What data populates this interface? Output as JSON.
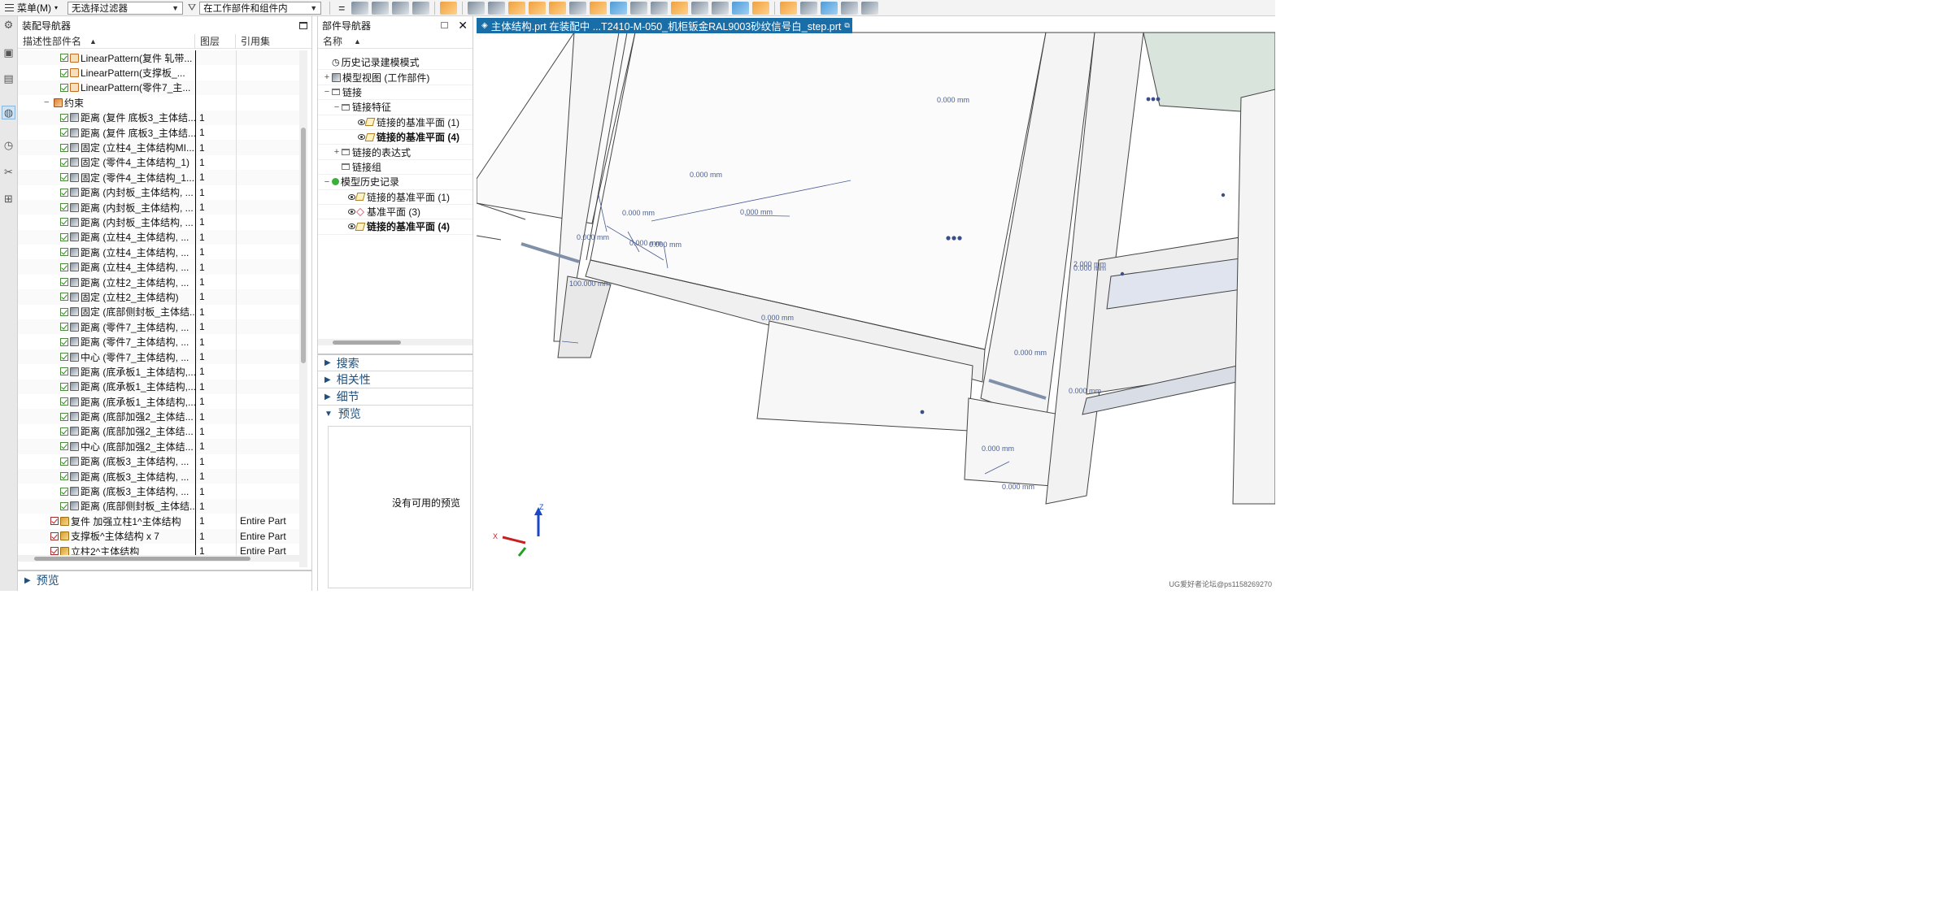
{
  "toolbar": {
    "menu_label": "菜单(M)",
    "filter_value": "无选择过滤器",
    "scope_value": "在工作部件和组件内"
  },
  "assembly_navigator": {
    "title": "装配导航器",
    "columns": [
      "描述性部件名",
      "图层",
      "引用集"
    ],
    "rows": [
      {
        "kind": "pattern",
        "name": "LinearPattern(复件 轧带...",
        "layer": "",
        "refset": "",
        "indent": 52
      },
      {
        "kind": "pattern",
        "name": "LinearPattern(支撑板_...",
        "layer": "",
        "refset": "",
        "indent": 52
      },
      {
        "kind": "pattern",
        "name": "LinearPattern(零件7_主...",
        "layer": "",
        "refset": "",
        "indent": 52
      },
      {
        "kind": "group",
        "name": "约束",
        "layer": "",
        "refset": "",
        "indent": 32
      },
      {
        "kind": "constraint",
        "name": "距离 (复件 底板3_主体结...",
        "layer": "1",
        "refset": "",
        "indent": 52
      },
      {
        "kind": "constraint",
        "name": "距离 (复件 底板3_主体结...",
        "layer": "1",
        "refset": "",
        "indent": 52
      },
      {
        "kind": "constraint",
        "name": "固定 (立柱4_主体结构MI...",
        "layer": "1",
        "refset": "",
        "indent": 52
      },
      {
        "kind": "constraint",
        "name": "固定 (零件4_主体结构_1)",
        "layer": "1",
        "refset": "",
        "indent": 52
      },
      {
        "kind": "constraint",
        "name": "固定 (零件4_主体结构_1...",
        "layer": "1",
        "refset": "",
        "indent": 52
      },
      {
        "kind": "constraint",
        "name": "距离 (内封板_主体结构, ...",
        "layer": "1",
        "refset": "",
        "indent": 52
      },
      {
        "kind": "constraint",
        "name": "距离 (内封板_主体结构, ...",
        "layer": "1",
        "refset": "",
        "indent": 52
      },
      {
        "kind": "constraint",
        "name": "距离 (内封板_主体结构, ...",
        "layer": "1",
        "refset": "",
        "indent": 52
      },
      {
        "kind": "constraint",
        "name": "距离 (立柱4_主体结构, ...",
        "layer": "1",
        "refset": "",
        "indent": 52
      },
      {
        "kind": "constraint",
        "name": "距离 (立柱4_主体结构, ...",
        "layer": "1",
        "refset": "",
        "indent": 52
      },
      {
        "kind": "constraint",
        "name": "距离 (立柱4_主体结构, ...",
        "layer": "1",
        "refset": "",
        "indent": 52
      },
      {
        "kind": "constraint",
        "name": "距离 (立柱2_主体结构, ...",
        "layer": "1",
        "refset": "",
        "indent": 52
      },
      {
        "kind": "constraint",
        "name": "固定 (立柱2_主体结构)",
        "layer": "1",
        "refset": "",
        "indent": 52
      },
      {
        "kind": "constraint",
        "name": "固定 (底部侧封板_主体结...",
        "layer": "1",
        "refset": "",
        "indent": 52
      },
      {
        "kind": "constraint",
        "name": "距离 (零件7_主体结构, ...",
        "layer": "1",
        "refset": "",
        "indent": 52
      },
      {
        "kind": "constraint",
        "name": "距离 (零件7_主体结构, ...",
        "layer": "1",
        "refset": "",
        "indent": 52
      },
      {
        "kind": "constraint",
        "name": "中心 (零件7_主体结构, ...",
        "layer": "1",
        "refset": "",
        "indent": 52
      },
      {
        "kind": "constraint",
        "name": "距离 (底承板1_主体结构,...",
        "layer": "1",
        "refset": "",
        "indent": 52
      },
      {
        "kind": "constraint",
        "name": "距离 (底承板1_主体结构,...",
        "layer": "1",
        "refset": "",
        "indent": 52
      },
      {
        "kind": "constraint",
        "name": "距离 (底承板1_主体结构,...",
        "layer": "1",
        "refset": "",
        "indent": 52
      },
      {
        "kind": "constraint",
        "name": "距离 (底部加强2_主体结...",
        "layer": "1",
        "refset": "",
        "indent": 52
      },
      {
        "kind": "constraint",
        "name": "距离 (底部加强2_主体结...",
        "layer": "1",
        "refset": "",
        "indent": 52
      },
      {
        "kind": "constraint",
        "name": "中心 (底部加强2_主体结...",
        "layer": "1",
        "refset": "",
        "indent": 52
      },
      {
        "kind": "constraint",
        "name": "距离 (底板3_主体结构, ...",
        "layer": "1",
        "refset": "",
        "indent": 52
      },
      {
        "kind": "constraint",
        "name": "距离 (底板3_主体结构, ...",
        "layer": "1",
        "refset": "",
        "indent": 52
      },
      {
        "kind": "constraint",
        "name": "距离 (底板3_主体结构, ...",
        "layer": "1",
        "refset": "",
        "indent": 52
      },
      {
        "kind": "constraint",
        "name": "距离 (底部侧封板_主体结...",
        "layer": "1",
        "refset": "",
        "indent": 52
      },
      {
        "kind": "part",
        "name": "复件 加强立柱1^主体结构",
        "layer": "1",
        "refset": "Entire Part",
        "indent": 40
      },
      {
        "kind": "part",
        "name": "支撑板^主体结构 x 7",
        "layer": "1",
        "refset": "Entire Part",
        "indent": 40
      },
      {
        "kind": "part",
        "name": "立柱2^主体结构",
        "layer": "1",
        "refset": "Entire Part",
        "indent": 40
      }
    ],
    "preview_label": "预览"
  },
  "part_navigator": {
    "title": "部件导航器",
    "column": "名称",
    "rows": [
      {
        "kind": "history",
        "name": "历史记录建模模式",
        "indent": 6,
        "expander": "",
        "bold": false,
        "eye": false
      },
      {
        "kind": "view",
        "name": "模型视图 (工作部件)",
        "indent": 6,
        "expander": "+",
        "bold": false,
        "eye": false
      },
      {
        "kind": "folder",
        "name": "链接",
        "indent": 6,
        "expander": "−",
        "bold": false,
        "eye": false
      },
      {
        "kind": "folder",
        "name": "链接特征",
        "indent": 18,
        "expander": "−",
        "bold": false,
        "eye": false
      },
      {
        "kind": "plane",
        "name": "链接的基准平面 (1)",
        "indent": 38,
        "expander": "",
        "bold": false,
        "eye": true
      },
      {
        "kind": "plane",
        "name": "链接的基准平面 (4)",
        "indent": 38,
        "expander": "",
        "bold": true,
        "eye": true
      },
      {
        "kind": "folder",
        "name": "链接的表达式",
        "indent": 18,
        "expander": "+",
        "bold": false,
        "eye": false
      },
      {
        "kind": "folder",
        "name": "链接组",
        "indent": 18,
        "expander": "",
        "bold": false,
        "eye": false
      },
      {
        "kind": "model",
        "name": "模型历史记录",
        "indent": 6,
        "expander": "−",
        "bold": false,
        "eye": false
      },
      {
        "kind": "plane",
        "name": "链接的基准平面 (1)",
        "indent": 26,
        "expander": "",
        "bold": false,
        "eye": true
      },
      {
        "kind": "plane-red",
        "name": "基准平面 (3)",
        "indent": 26,
        "expander": "",
        "bold": false,
        "eye": true
      },
      {
        "kind": "plane",
        "name": "链接的基准平面 (4)",
        "indent": 26,
        "expander": "",
        "bold": true,
        "eye": true
      }
    ],
    "sections": [
      "搜索",
      "相关性",
      "细节",
      "预览"
    ],
    "preview_empty": "没有可用的预览"
  },
  "graphics": {
    "tab_title": "主体结构.prt 在装配中 ...T2410-M-050_机柜钣金RAL9003砂纹信号白_step.prt",
    "dimensions": [
      "0.000 mm",
      "0.000 mm",
      "0.000 mm",
      "0.000 mm",
      "0.000 mm",
      "0.000 mm",
      "100.000 mm",
      "0.000 mm",
      "0.000 mm",
      "2.000 mm",
      "0.000 mm",
      "0.000 mm",
      "0.000 mm",
      "0.000 mm",
      "0.000 mm"
    ],
    "axes": {
      "z": "Z",
      "x": "X"
    },
    "watermark": "UG爱好者论坛@ps1158269270"
  }
}
